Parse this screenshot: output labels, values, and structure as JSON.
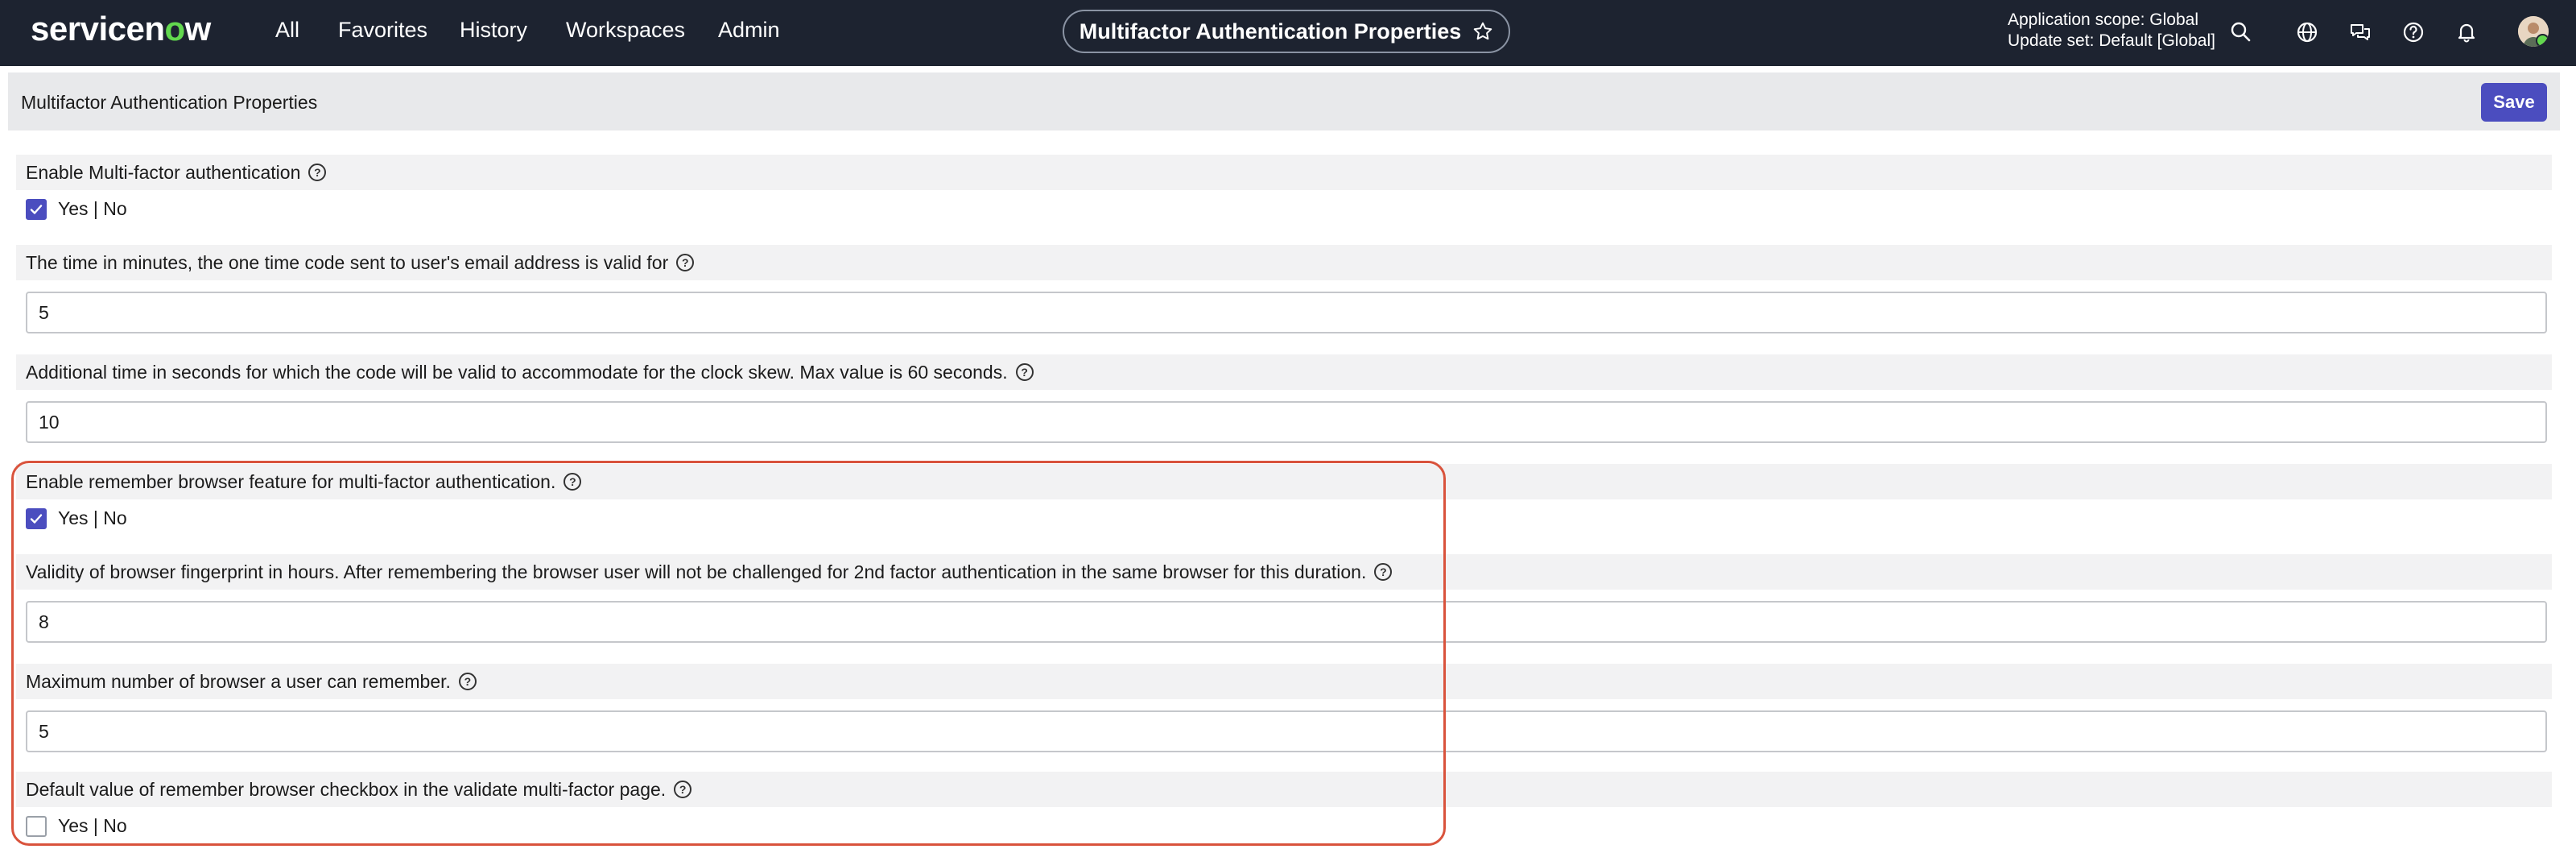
{
  "topbar": {
    "logo": "servicenow",
    "nav": [
      "All",
      "Favorites",
      "History",
      "Workspaces",
      "Admin"
    ],
    "page_title": "Multifactor Authentication Properties",
    "scope_line1": "Application scope: Global",
    "scope_line2": "Update set: Default [Global]",
    "icons": [
      "search-icon",
      "globe-icon",
      "chat-icon",
      "help-icon",
      "bell-icon",
      "avatar"
    ]
  },
  "header": {
    "title": "Multifactor Authentication Properties",
    "save_label": "Save"
  },
  "properties": [
    {
      "label": "Enable Multi-factor authentication",
      "type": "checkbox",
      "checked": true,
      "option_text": "Yes | No"
    },
    {
      "label": "The time in minutes, the one time code sent to user's email address is valid for",
      "type": "text",
      "value": "5"
    },
    {
      "label": "Additional time in seconds for which the code will be valid to accommodate for the clock skew. Max value is 60 seconds.",
      "type": "text",
      "value": "10"
    },
    {
      "label": "Enable remember browser feature for multi-factor authentication.",
      "type": "checkbox",
      "checked": true,
      "option_text": "Yes | No"
    },
    {
      "label": "Validity of browser fingerprint in hours. After remembering the browser user will not be challenged for 2nd factor authentication in the same browser for this duration.",
      "type": "text",
      "value": "8"
    },
    {
      "label": "Maximum number of browser a user can remember.",
      "type": "text",
      "value": "5"
    },
    {
      "label": "Default value of remember browser checkbox in the validate multi-factor page.",
      "type": "checkbox",
      "checked": false,
      "option_text": "Yes | No"
    }
  ],
  "colors": {
    "topbar_bg": "#1d2330",
    "accent": "#4b4dbf",
    "highlight_border": "#d9533c"
  }
}
